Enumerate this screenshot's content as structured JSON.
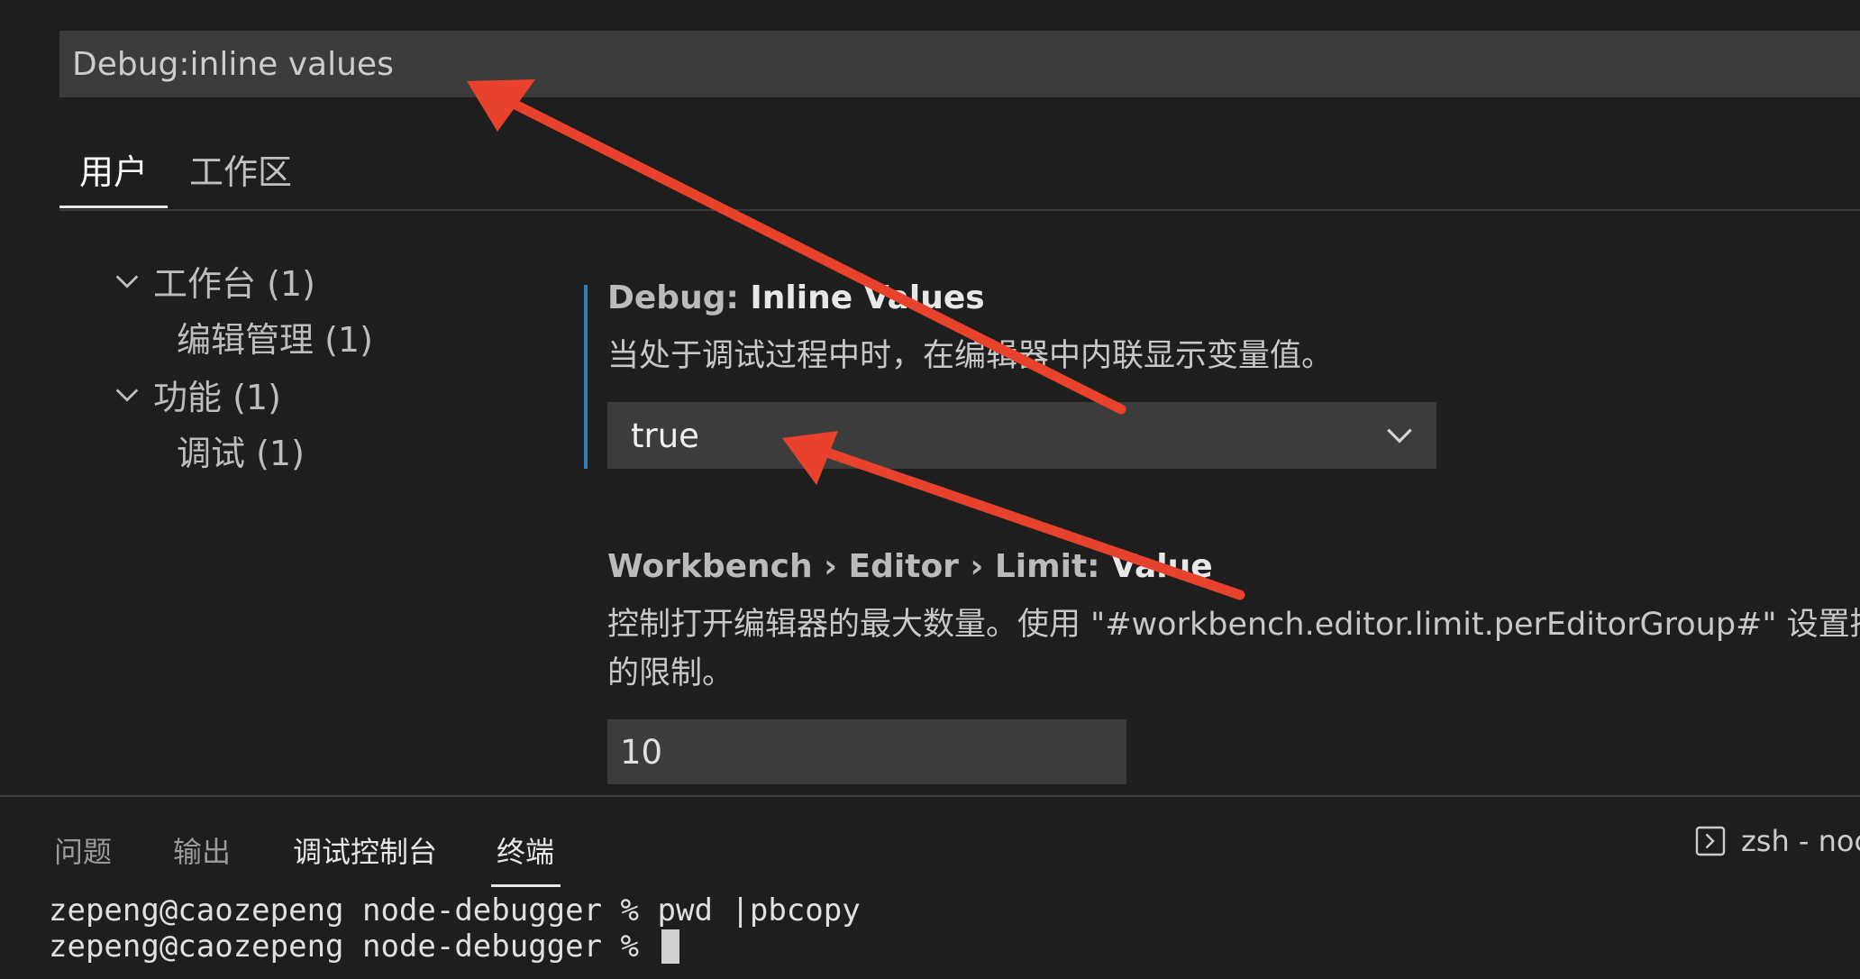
{
  "search": {
    "value": "Debug:inline values"
  },
  "scope_tabs": [
    {
      "label": "用户",
      "active": true
    },
    {
      "label": "工作区",
      "active": false
    }
  ],
  "toc": [
    {
      "label": "工作台 (1)",
      "expanded": true,
      "level": 0
    },
    {
      "label": "编辑管理 (1)",
      "level": 1
    },
    {
      "label": "功能 (1)",
      "expanded": true,
      "level": 0
    },
    {
      "label": "调试 (1)",
      "level": 1
    }
  ],
  "settings": [
    {
      "category": "Debug: ",
      "key": "Inline Values",
      "description": "当处于调试过程中时，在编辑器中内联显示变量值。",
      "value": "true",
      "control": "select"
    },
    {
      "category": "Workbench › Editor › Limit: ",
      "key": "Value",
      "description_line1": "控制打开编辑器的最大数量。使用 \"#workbench.editor.limit.perEditorGroup#\" 设置控",
      "description_line2": "的限制。",
      "value": "10",
      "control": "number"
    }
  ],
  "panel": {
    "tabs": [
      "问题",
      "输出",
      "调试控制台",
      "终端"
    ],
    "active_tab": "终端",
    "terminal_select": "zsh - noc",
    "terminal_lines": [
      "zepeng@caozepeng node-debugger % pwd |pbcopy",
      "zepeng@caozepeng node-debugger % "
    ]
  },
  "colors": {
    "background": "#1e1e1e",
    "input_background": "#3c3c3c",
    "modified_indicator": "#2f7fb8",
    "annotation_arrow": "#e8412c"
  },
  "icons": [
    "chevron-down-icon",
    "dropdown-chevron-icon",
    "terminal-icon"
  ]
}
